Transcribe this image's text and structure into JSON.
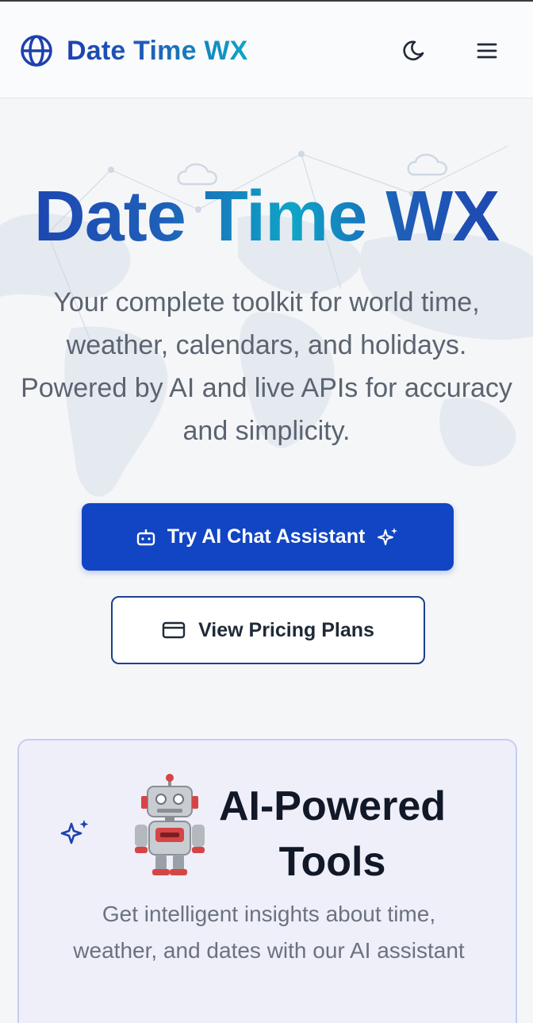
{
  "header": {
    "brand": "Date Time WX",
    "icons": {
      "logo": "globe-icon",
      "theme": "moon-icon",
      "menu": "hamburger-menu-icon"
    }
  },
  "hero": {
    "title": "Date Time WX",
    "subtitle": "Your complete toolkit for world time, weather, calendars, and holidays. Powered by AI and live APIs for accuracy and simplicity.",
    "primary_button": {
      "label": "Try AI Chat Assistant",
      "icon": "bot-icon",
      "trailing_icon": "sparkles-icon"
    },
    "secondary_button": {
      "label": "View Pricing Plans",
      "icon": "credit-card-icon"
    }
  },
  "ai_card": {
    "title": "AI-Powered Tools",
    "description": "Get intelligent insights about time, weather, and dates with our AI assistant",
    "icons": {
      "left": "sparkles-icon",
      "emoji": "robot-icon"
    }
  },
  "colors": {
    "brand_blue": "#1e40af",
    "accent_cyan": "#0ea5c6",
    "primary_button": "#1145c4",
    "card_bg": "#efeff9"
  }
}
